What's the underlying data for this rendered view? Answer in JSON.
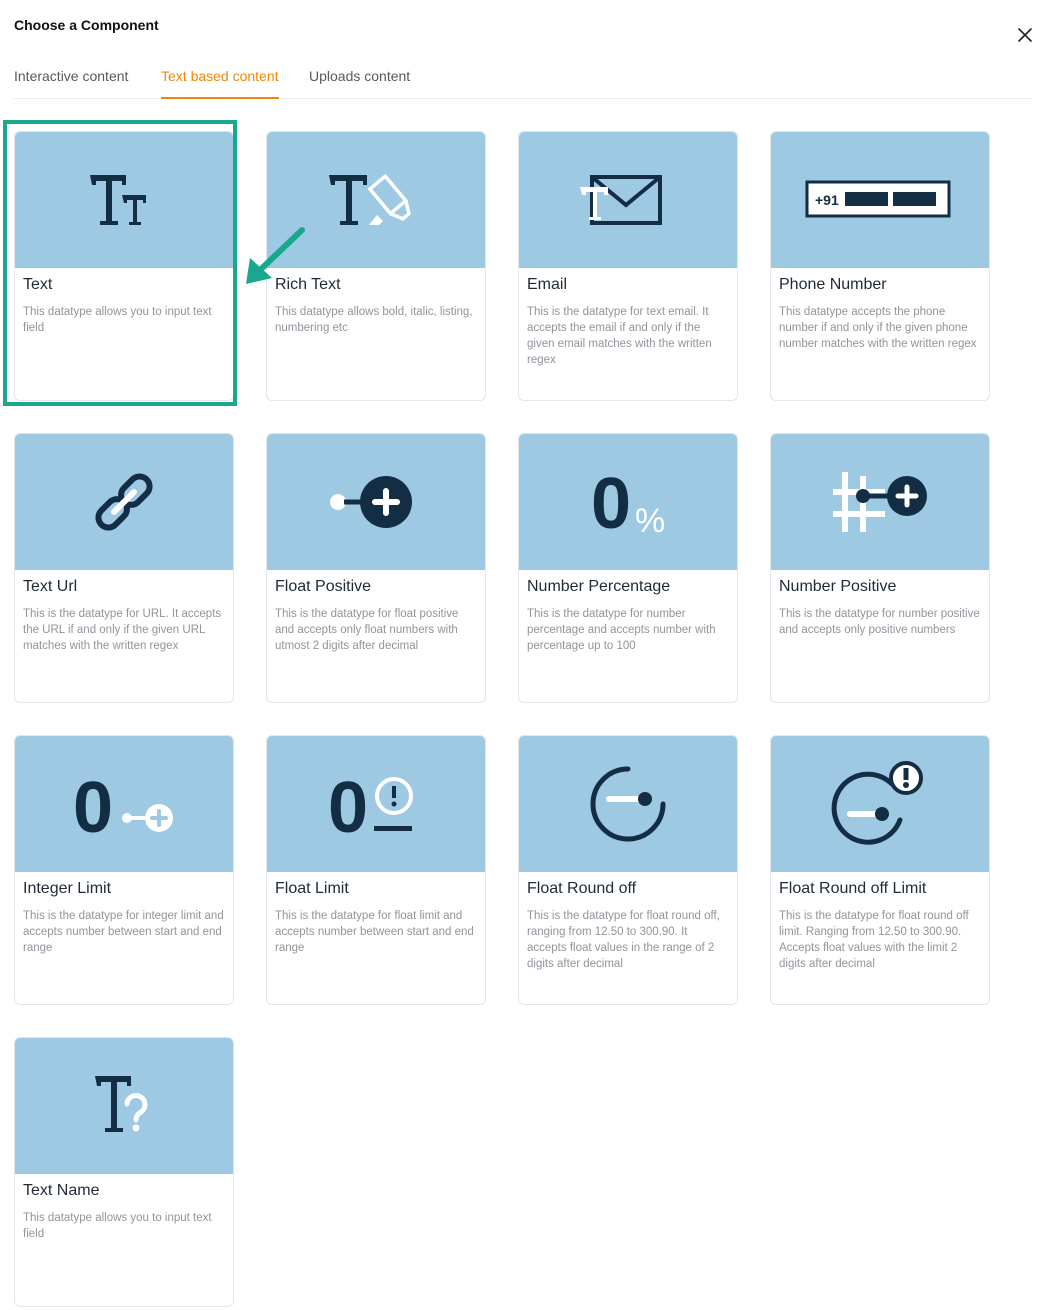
{
  "modal": {
    "title": "Choose a Component",
    "close_icon": "close-icon"
  },
  "tabs": [
    {
      "label": "Interactive content",
      "active": false
    },
    {
      "label": "Text based content",
      "active": true
    },
    {
      "label": "Uploads content",
      "active": false
    }
  ],
  "colors": {
    "accent": "#f0860a",
    "card_image_bg": "#9dc9e3",
    "icon_dark": "#132d45",
    "highlight": "#17a88d"
  },
  "cards": [
    {
      "title": "Text",
      "description": "This datatype allows you to input text field",
      "icon": "text-tt-icon",
      "selected": true
    },
    {
      "title": "Rich Text",
      "description": "This datatype allows bold, italic, listing, numbering etc",
      "icon": "rich-text-icon"
    },
    {
      "title": "Email",
      "description": "This is the datatype for text email. It accepts the email if and only if the given email matches with the written regex",
      "icon": "email-icon"
    },
    {
      "title": "Phone Number",
      "description": "This datatype accepts the phone number if and only if the given phone number matches with the written regex",
      "icon": "phone-number-icon",
      "icon_text": "+91"
    },
    {
      "title": "Text Url",
      "description": "This is the datatype for URL. It accepts the URL if and only if the given URL matches with the written regex",
      "icon": "link-icon"
    },
    {
      "title": "Float Positive",
      "description": "This is the datatype for float positive and accepts only float numbers with utmost 2 digits after decimal",
      "icon": "float-positive-icon"
    },
    {
      "title": "Number Percentage",
      "description": "This is the datatype for number percentage and accepts number with percentage up to 100",
      "icon": "number-percentage-icon",
      "icon_text": "0",
      "icon_text2": "%"
    },
    {
      "title": "Number Positive",
      "description": "This is the datatype for number positive and accepts only positive numbers",
      "icon": "number-positive-icon"
    },
    {
      "title": "Integer Limit",
      "description": "This is the datatype for integer limit and accepts number between start and end range",
      "icon": "integer-limit-icon",
      "icon_text": "0"
    },
    {
      "title": "Float Limit",
      "description": "This is the datatype for float limit and accepts number between start and end range",
      "icon": "float-limit-icon",
      "icon_text": "0"
    },
    {
      "title": "Float Round off",
      "description": "This is the datatype for float round off, ranging from 12.50 to 300.90. It accepts float values in the range of 2 digits after decimal",
      "icon": "float-round-off-icon"
    },
    {
      "title": "Float Round off Limit",
      "description": "This is the datatype for float round off limit. Ranging from 12.50 to 300.90. Accepts float values with the limit 2 digits after decimal",
      "icon": "float-round-off-limit-icon"
    },
    {
      "title": "Text Name",
      "description": "This datatype allows you to input text field",
      "icon": "text-name-icon"
    }
  ],
  "annotation": {
    "highlight_icon": "selection-highlight-box",
    "arrow_icon": "pointer-arrow-icon"
  }
}
